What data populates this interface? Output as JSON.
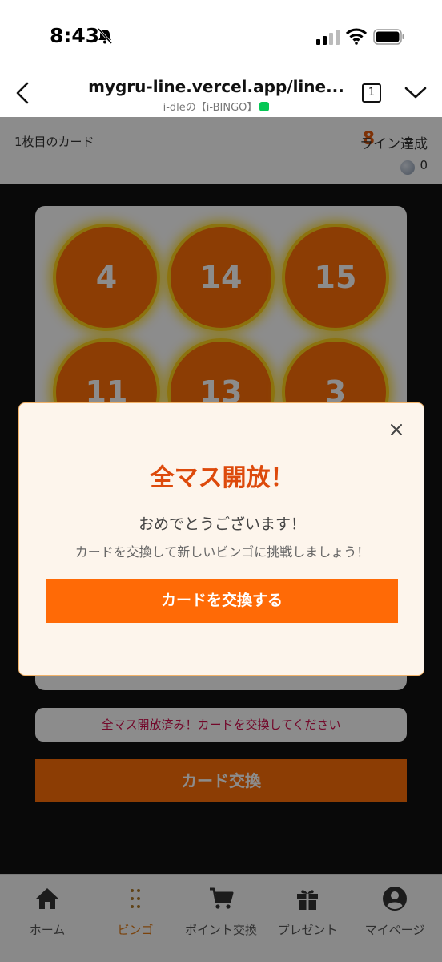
{
  "status_bar": {
    "time": "8:43",
    "icons": [
      "bell-slash-icon",
      "signal-icon",
      "wifi-icon",
      "battery-icon"
    ]
  },
  "browser": {
    "url": "mygru-line.vercel.app/line...",
    "subtitle": "i-dleの【i-BINGO】",
    "tab_count": "1"
  },
  "card_header": {
    "title": "1枚目のカード",
    "lines_count": "8",
    "lines_label": "ライン達成",
    "coin_count": "0"
  },
  "bingo_cells": [
    "4",
    "14",
    "15",
    "11",
    "13",
    "3"
  ],
  "status_message": "全マス開放済み！カードを交換してください",
  "exchange_button": "カード交換",
  "modal": {
    "title": "全マス開放！",
    "message1": "おめでとうございます！",
    "message2": "カードを交換して新しいビンゴに挑戦しましょう！",
    "button": "カードを交換する"
  },
  "nav": [
    {
      "label": "ホーム",
      "icon": "home-icon"
    },
    {
      "label": "ビンゴ",
      "icon": "bingo-grid-icon",
      "active": true
    },
    {
      "label": "ポイント交換",
      "icon": "cart-icon"
    },
    {
      "label": "プレゼント",
      "icon": "gift-icon"
    },
    {
      "label": "マイページ",
      "icon": "user-icon"
    }
  ],
  "colors": {
    "accent": "#ff6f08",
    "alert_text": "#d10f4e",
    "active_nav": "#e07b17"
  }
}
